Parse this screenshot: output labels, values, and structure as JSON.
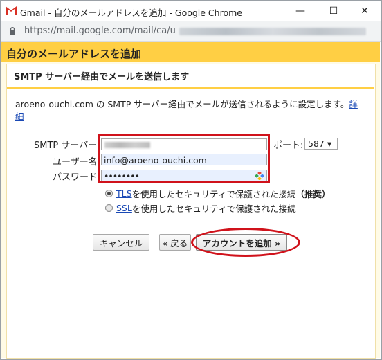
{
  "window": {
    "title": "Gmail - 自分のメールアドレスを追加 - Google Chrome",
    "url": "https://mail.google.com/mail/ca/u",
    "controls": {
      "minimize": "—",
      "maximize": "☐",
      "close": "✕"
    }
  },
  "dialog": {
    "header": "自分のメールアドレスを追加",
    "subheading": "SMTP サーバー経由でメールを送信します",
    "description": "aroeno-ouchi.com の SMTP サーバー経由でメールが送信されるように設定します。",
    "details_link": "詳細",
    "form": {
      "smtp_label": "SMTP サーバー",
      "port_label": "ポート:",
      "port_value": "587 ▾",
      "username_label": "ユーザー名:",
      "username_value": "info@aroeno-ouchi.com",
      "password_label": "パスワード:",
      "password_value": "••••••••",
      "tls": {
        "link": "TLS",
        "text": " を使用したセキュリティで保護された接続",
        "suffix": "（推奨）",
        "checked": true
      },
      "ssl": {
        "link": "SSL",
        "text": " を使用したセキュリティで保護された接続",
        "checked": false
      }
    },
    "buttons": {
      "cancel": "キャンセル",
      "back": "« 戻る",
      "add_account": "アカウントを追加 »"
    }
  },
  "colors": {
    "header": "#ffcf44",
    "highlight": "#d0121b",
    "link": "#1a49b5"
  }
}
